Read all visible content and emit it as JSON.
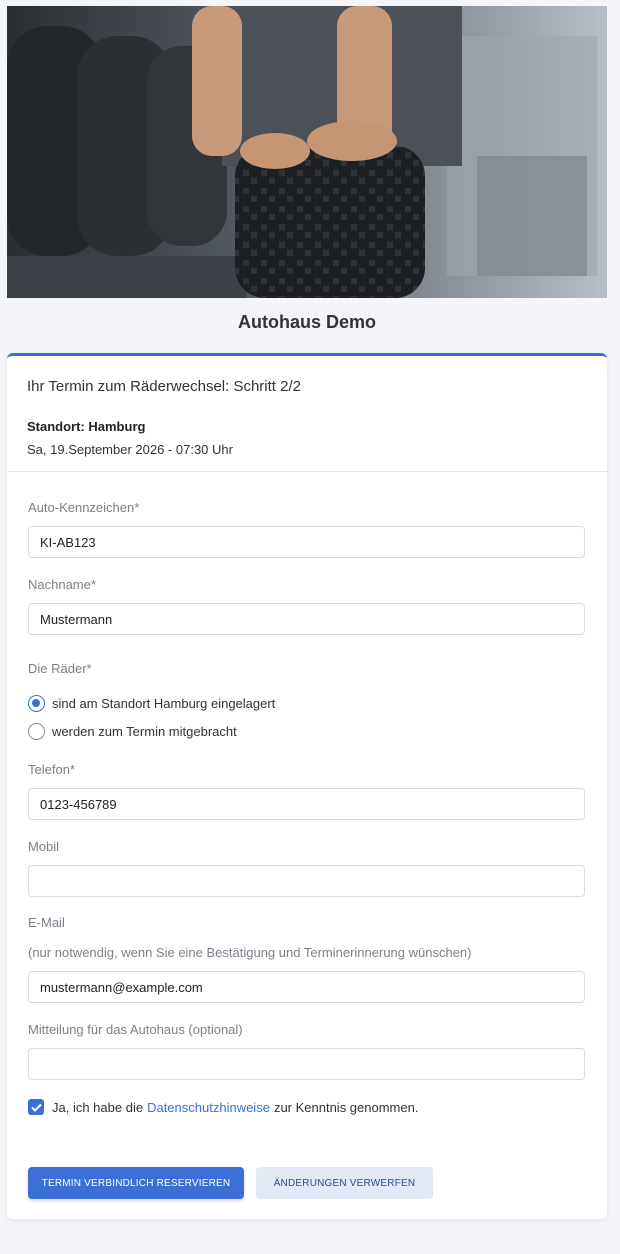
{
  "brand": {
    "title": "Autohaus Demo"
  },
  "booking": {
    "step_title": "Ihr Termin zum Räderwechsel: Schritt 2/2",
    "location": "Standort: Hamburg",
    "datetime": "Sa, 19.September 2026 - 07:30 Uhr"
  },
  "form": {
    "plate": {
      "label": "Auto-Kennzeichen*",
      "value": "KI-AB123"
    },
    "lastname": {
      "label": "Nachname*",
      "value": "Mustermann"
    },
    "wheels": {
      "label": "Die Räder*",
      "options": [
        "sind am Standort Hamburg eingelagert",
        "werden zum Termin mitgebracht"
      ],
      "selected": 0
    },
    "phone": {
      "label": "Telefon*",
      "value": "0123-456789"
    },
    "mobile": {
      "label": "Mobil",
      "value": ""
    },
    "email": {
      "label": "E-Mail",
      "hint": "(nur notwendig, wenn Sie eine Bestätigung und Terminerinnerung wünschen)",
      "value": "mustermann@example.com"
    },
    "message": {
      "label": "Mitteilung für das Autohaus (optional)",
      "value": ""
    },
    "privacy": {
      "checked": true,
      "text_before": "Ja, ich habe die",
      "link": "Datenschutzhinweise",
      "text_after": "zur Kenntnis genommen."
    }
  },
  "actions": {
    "submit": "TERMIN VERBINDLICH RESERVIEREN",
    "discard": "ÄNDERUNGEN VERWERFEN"
  },
  "colors": {
    "accent": "#3a6fd8",
    "background": "#f3f5f9"
  }
}
